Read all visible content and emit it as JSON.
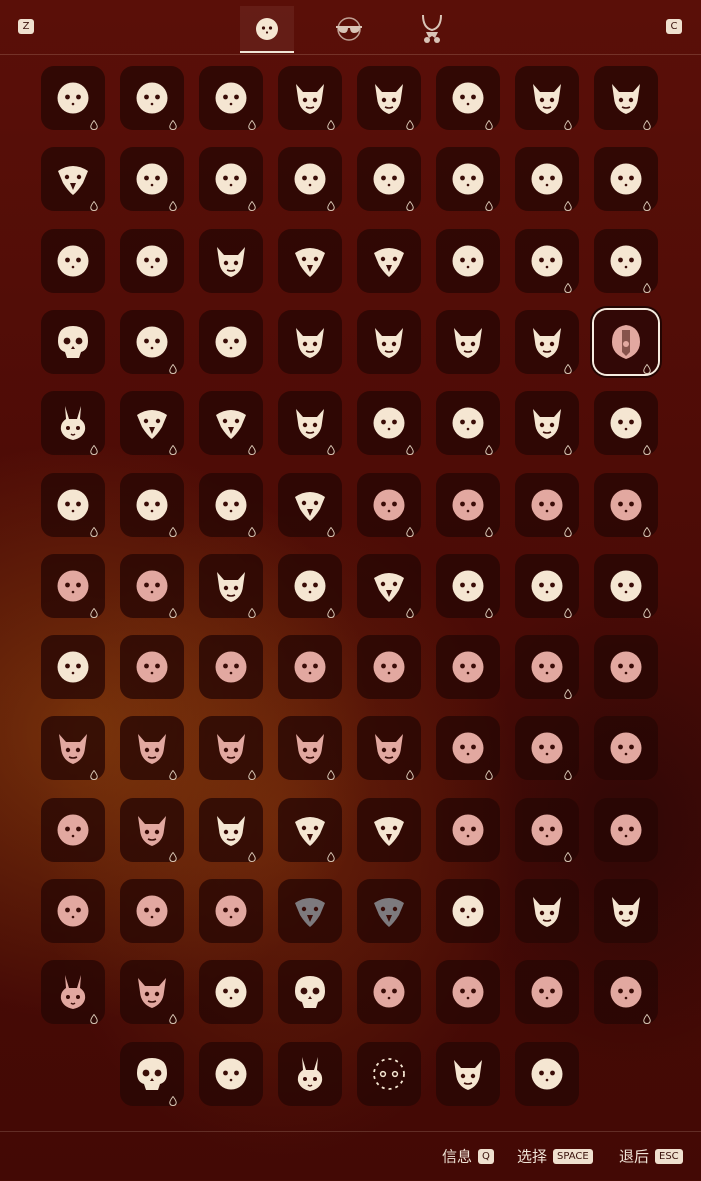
{
  "header": {
    "prev_key": "Z",
    "next_key": "C",
    "tabs": [
      {
        "id": "faces",
        "icon": "face-icon",
        "active": true
      },
      {
        "id": "hats",
        "icon": "sunglasses-icon",
        "active": false
      },
      {
        "id": "necklaces",
        "icon": "necklace-icon",
        "active": false
      }
    ]
  },
  "grid": {
    "columns": 8,
    "selected_index": 31,
    "items": [
      {
        "icon": "face-mask-icon",
        "tone": "cream",
        "drop": true
      },
      {
        "icon": "face-mask-icon",
        "tone": "cream",
        "drop": true
      },
      {
        "icon": "face-mask-icon",
        "tone": "cream",
        "drop": true
      },
      {
        "icon": "horned-mask-icon",
        "tone": "cream",
        "drop": true
      },
      {
        "icon": "horned-mask-icon",
        "tone": "cream",
        "drop": true
      },
      {
        "icon": "face-mask-icon",
        "tone": "cream",
        "drop": true
      },
      {
        "icon": "horned-mask-icon",
        "tone": "cream",
        "drop": true
      },
      {
        "icon": "horned-mask-icon",
        "tone": "cream",
        "drop": true
      },
      {
        "icon": "bird-mask-icon",
        "tone": "cream",
        "drop": true
      },
      {
        "icon": "face-mask-icon",
        "tone": "cream",
        "drop": true
      },
      {
        "icon": "face-mask-icon",
        "tone": "cream",
        "drop": true
      },
      {
        "icon": "face-mask-icon",
        "tone": "cream",
        "drop": true
      },
      {
        "icon": "face-mask-icon",
        "tone": "cream",
        "drop": true
      },
      {
        "icon": "face-mask-icon",
        "tone": "cream",
        "drop": true
      },
      {
        "icon": "face-mask-icon",
        "tone": "cream",
        "drop": true
      },
      {
        "icon": "face-mask-icon",
        "tone": "cream",
        "drop": true
      },
      {
        "icon": "face-mask-icon",
        "tone": "cream",
        "drop": false
      },
      {
        "icon": "face-mask-icon",
        "tone": "cream",
        "drop": false
      },
      {
        "icon": "horned-mask-icon",
        "tone": "cream",
        "drop": false
      },
      {
        "icon": "bird-mask-icon",
        "tone": "cream",
        "drop": false
      },
      {
        "icon": "bird-mask-icon",
        "tone": "cream",
        "drop": false
      },
      {
        "icon": "face-mask-icon",
        "tone": "cream",
        "drop": false
      },
      {
        "icon": "face-mask-icon",
        "tone": "cream",
        "drop": true
      },
      {
        "icon": "face-mask-icon",
        "tone": "cream",
        "drop": true
      },
      {
        "icon": "skull-mask-icon",
        "tone": "cream",
        "drop": false
      },
      {
        "icon": "face-mask-icon",
        "tone": "cream",
        "drop": true
      },
      {
        "icon": "face-mask-icon",
        "tone": "cream",
        "drop": false
      },
      {
        "icon": "horned-mask-icon",
        "tone": "cream",
        "drop": false
      },
      {
        "icon": "horned-mask-icon",
        "tone": "cream",
        "drop": false
      },
      {
        "icon": "horned-mask-icon",
        "tone": "cream",
        "drop": false
      },
      {
        "icon": "horned-mask-icon",
        "tone": "cream",
        "drop": true
      },
      {
        "icon": "helmet-mask-icon",
        "tone": "pink",
        "drop": true
      },
      {
        "icon": "rabbit-mask-icon",
        "tone": "cream",
        "drop": true
      },
      {
        "icon": "bird-mask-icon",
        "tone": "cream",
        "drop": true
      },
      {
        "icon": "bird-mask-icon",
        "tone": "cream",
        "drop": true
      },
      {
        "icon": "horned-mask-icon",
        "tone": "cream",
        "drop": true
      },
      {
        "icon": "face-mask-icon",
        "tone": "cream",
        "drop": true
      },
      {
        "icon": "face-mask-icon",
        "tone": "cream",
        "drop": true
      },
      {
        "icon": "horned-mask-icon",
        "tone": "cream",
        "drop": true
      },
      {
        "icon": "face-mask-icon",
        "tone": "cream",
        "drop": true
      },
      {
        "icon": "face-mask-icon",
        "tone": "cream",
        "drop": true
      },
      {
        "icon": "face-mask-icon",
        "tone": "cream",
        "drop": true
      },
      {
        "icon": "face-mask-icon",
        "tone": "cream",
        "drop": true
      },
      {
        "icon": "bird-mask-icon",
        "tone": "cream",
        "drop": true
      },
      {
        "icon": "face-mask-icon",
        "tone": "pink",
        "drop": true
      },
      {
        "icon": "face-mask-icon",
        "tone": "pink",
        "drop": true
      },
      {
        "icon": "face-mask-icon",
        "tone": "pink",
        "drop": true
      },
      {
        "icon": "face-mask-icon",
        "tone": "pink",
        "drop": true
      },
      {
        "icon": "face-mask-icon",
        "tone": "pink",
        "drop": true
      },
      {
        "icon": "face-mask-icon",
        "tone": "pink",
        "drop": true
      },
      {
        "icon": "horned-mask-icon",
        "tone": "cream",
        "drop": true
      },
      {
        "icon": "face-mask-icon",
        "tone": "cream",
        "drop": true
      },
      {
        "icon": "bird-mask-icon",
        "tone": "cream",
        "drop": true
      },
      {
        "icon": "face-mask-icon",
        "tone": "cream",
        "drop": true
      },
      {
        "icon": "face-mask-icon",
        "tone": "cream",
        "drop": true
      },
      {
        "icon": "face-mask-icon",
        "tone": "cream",
        "drop": true
      },
      {
        "icon": "face-mask-icon",
        "tone": "cream",
        "drop": false
      },
      {
        "icon": "face-mask-icon",
        "tone": "pink",
        "drop": false
      },
      {
        "icon": "face-mask-icon",
        "tone": "pink",
        "drop": false
      },
      {
        "icon": "face-mask-icon",
        "tone": "pink",
        "drop": false
      },
      {
        "icon": "face-mask-icon",
        "tone": "pink",
        "drop": false
      },
      {
        "icon": "face-mask-icon",
        "tone": "pink",
        "drop": false
      },
      {
        "icon": "face-mask-icon",
        "tone": "pink",
        "drop": true
      },
      {
        "icon": "face-mask-icon",
        "tone": "pink",
        "drop": false
      },
      {
        "icon": "horned-mask-icon",
        "tone": "pink",
        "drop": true
      },
      {
        "icon": "horned-mask-icon",
        "tone": "pink",
        "drop": true
      },
      {
        "icon": "horned-mask-icon",
        "tone": "pink",
        "drop": true
      },
      {
        "icon": "horned-mask-icon",
        "tone": "pink",
        "drop": true
      },
      {
        "icon": "horned-mask-icon",
        "tone": "pink",
        "drop": true
      },
      {
        "icon": "face-mask-icon",
        "tone": "pink",
        "drop": true
      },
      {
        "icon": "face-mask-icon",
        "tone": "pink",
        "drop": true
      },
      {
        "icon": "face-mask-icon",
        "tone": "pink",
        "drop": false
      },
      {
        "icon": "face-mask-icon",
        "tone": "pink",
        "drop": false
      },
      {
        "icon": "horned-mask-icon",
        "tone": "pink",
        "drop": true
      },
      {
        "icon": "horned-mask-icon",
        "tone": "cream",
        "drop": true
      },
      {
        "icon": "bird-mask-icon",
        "tone": "cream",
        "drop": true
      },
      {
        "icon": "bird-mask-icon",
        "tone": "cream",
        "drop": false
      },
      {
        "icon": "face-mask-icon",
        "tone": "pink",
        "drop": false
      },
      {
        "icon": "face-mask-icon",
        "tone": "pink",
        "drop": true
      },
      {
        "icon": "face-mask-icon",
        "tone": "pink",
        "drop": false
      },
      {
        "icon": "face-mask-icon",
        "tone": "pink",
        "drop": false
      },
      {
        "icon": "face-mask-icon",
        "tone": "pink",
        "drop": false
      },
      {
        "icon": "face-mask-icon",
        "tone": "pink",
        "drop": false
      },
      {
        "icon": "bird-mask-icon",
        "tone": "grey",
        "drop": false
      },
      {
        "icon": "bird-mask-icon",
        "tone": "grey",
        "drop": false
      },
      {
        "icon": "face-mask-icon",
        "tone": "cream",
        "drop": false
      },
      {
        "icon": "horned-mask-icon",
        "tone": "cream",
        "drop": false
      },
      {
        "icon": "horned-mask-icon",
        "tone": "cream",
        "drop": false
      },
      {
        "icon": "rabbit-mask-icon",
        "tone": "pink",
        "drop": true
      },
      {
        "icon": "horned-mask-icon",
        "tone": "pink",
        "drop": true
      },
      {
        "icon": "face-mask-icon",
        "tone": "cream",
        "drop": false
      },
      {
        "icon": "skull-mask-icon",
        "tone": "cream",
        "drop": false
      },
      {
        "icon": "face-mask-icon",
        "tone": "pink",
        "drop": false
      },
      {
        "icon": "face-mask-icon",
        "tone": "pink",
        "drop": false
      },
      {
        "icon": "face-mask-icon",
        "tone": "pink",
        "drop": false
      },
      {
        "icon": "face-mask-icon",
        "tone": "pink",
        "drop": true
      },
      {
        "icon": "skull-mask-icon",
        "tone": "cream",
        "drop": true
      },
      {
        "icon": "face-mask-icon",
        "tone": "cream",
        "drop": false
      },
      {
        "icon": "rabbit-mask-icon",
        "tone": "cream",
        "drop": false
      },
      {
        "icon": "dashed-ring-icon",
        "tone": "cream",
        "drop": false
      },
      {
        "icon": "horned-mask-icon",
        "tone": "cream",
        "drop": false
      },
      {
        "icon": "face-mask-icon",
        "tone": "cream",
        "drop": false
      }
    ]
  },
  "footer": {
    "info_label": "信息",
    "info_key": "Q",
    "select_label": "选择",
    "select_key": "SPACE",
    "back_label": "退后",
    "back_key": "ESC"
  },
  "colors": {
    "background": "#4a0c06",
    "cell": "#26060480",
    "cream": "#f5e6d2",
    "pink": "#e2a8a0",
    "grey": "#7d7a7e",
    "feature": "#3a0d08"
  }
}
